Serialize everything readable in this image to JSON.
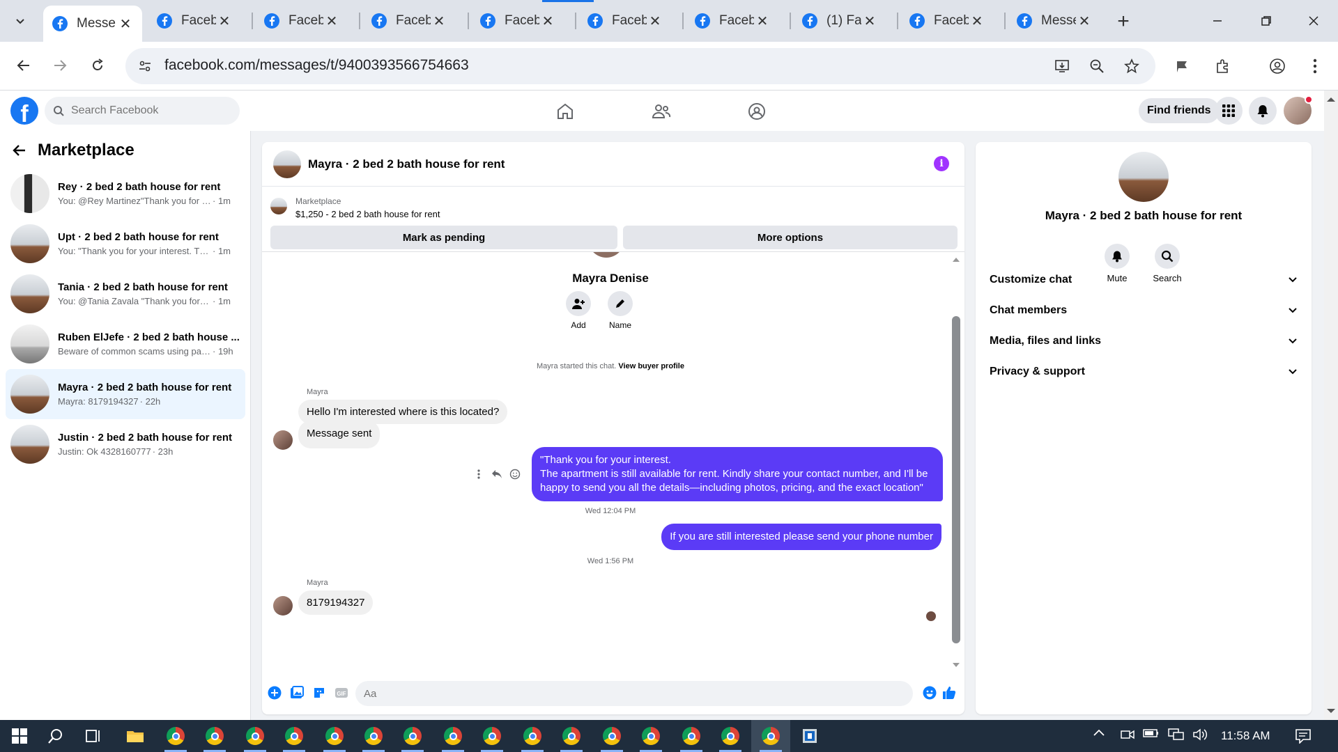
{
  "browser": {
    "tabs": [
      {
        "title": "Messe",
        "active": true
      },
      {
        "title": "Faceb",
        "active": false
      },
      {
        "title": "Faceb",
        "active": false
      },
      {
        "title": "Faceb",
        "active": false
      },
      {
        "title": "Faceb",
        "active": false
      },
      {
        "title": "Faceb",
        "active": false
      },
      {
        "title": "Faceb",
        "active": false
      },
      {
        "title": "(1) Fa",
        "active": false
      },
      {
        "title": "Faceb",
        "active": false
      },
      {
        "title": "Messe",
        "active": false
      }
    ],
    "url": "facebook.com/messages/t/9400393566754663"
  },
  "fb_header": {
    "logo": "f",
    "search_placeholder": "Search Facebook",
    "find_friends_label": "Find friends"
  },
  "sidebar": {
    "title": "Marketplace",
    "conversations": [
      {
        "name": "Rey · 2 bed 2 bath house for rent",
        "preview": "You: @Rey Martinez\"Thank you for y...",
        "time": " · 1m"
      },
      {
        "name": "Upt · 2 bed 2 bath house for rent",
        "preview": "You: \"Thank you for your interest. The...",
        "time": " · 1m"
      },
      {
        "name": "Tania · 2 bed 2 bath house for rent",
        "preview": "You: @Tania Zavala \"Thank you for yo...",
        "time": " · 1m"
      },
      {
        "name": "Ruben ElJefe · 2 bed 2 bath house ...",
        "preview": "Beware of common scams using pay...",
        "time": " · 19h"
      },
      {
        "name": "Mayra · 2 bed 2 bath house for rent",
        "preview": "Mayra: 8179194327",
        "time": " · 22h"
      },
      {
        "name": "Justin · 2 bed 2 bath house for rent",
        "preview": "Justin: Ok 4328160777",
        "time": " · 23h"
      }
    ]
  },
  "chat": {
    "title": "Mayra · 2 bed 2 bath house for rent",
    "marketplace_label": "Marketplace",
    "product": "$1,250 - 2 bed 2 bath house for rent",
    "mark_pending_label": "Mark as pending",
    "more_options_label": "More options",
    "contact_name": "Mayra Denise",
    "add_label": "Add",
    "name_label": "Name",
    "system_text": "Mayra started this chat.",
    "view_buyer_profile": "View buyer profile",
    "sender_1": "Mayra",
    "msg_in_1": "Hello I'm interested where is this located?",
    "msg_in_2": "Message sent",
    "msg_out_1": "\"Thank you for your interest.\nThe apartment is still available for rent. Kindly share your contact number, and I'll be happy to send you all the details—including photos, pricing, and the exact location\"",
    "timestamp_1": "Wed 12:04 PM",
    "msg_out_2": "If you are still interested please send your phone number",
    "timestamp_2": "Wed 1:56 PM",
    "sender_2": "Mayra",
    "msg_in_3": "8179194327",
    "composer_placeholder": "Aa"
  },
  "details": {
    "name": "Mayra · 2 bed 2 bath house for rent",
    "mute_label": "Mute",
    "search_label": "Search",
    "sections": [
      "Customize chat",
      "Chat members",
      "Media, files and links",
      "Privacy & support"
    ]
  },
  "taskbar": {
    "time": "11:58 AM"
  },
  "colors": {
    "fb_blue": "#1877f2",
    "out_bubble": "#5b3bf6",
    "info_purple": "#a033ff"
  }
}
